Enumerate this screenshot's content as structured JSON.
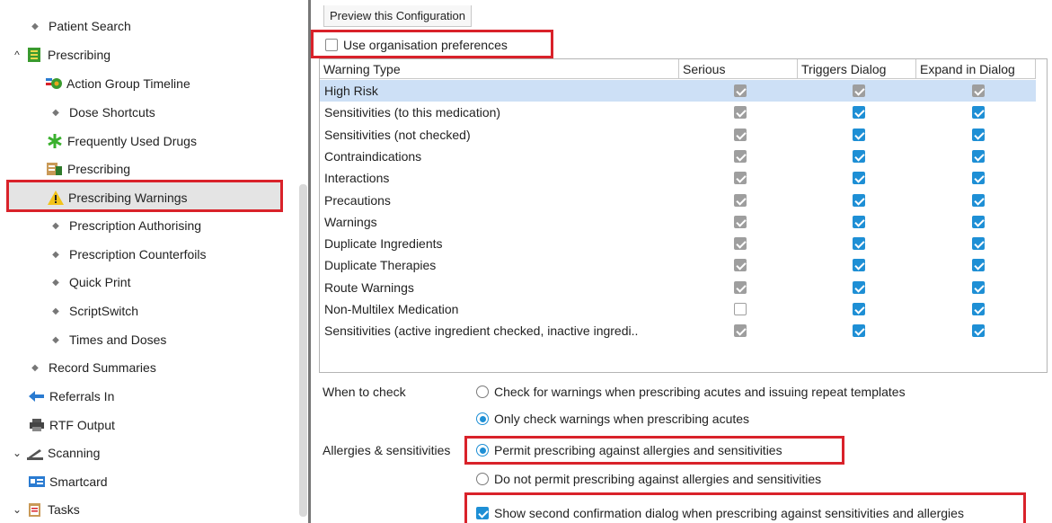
{
  "sidebar": {
    "items": [
      {
        "label": "Patient Search",
        "type": "leaf"
      },
      {
        "label": "Prescribing",
        "type": "group",
        "expanded": true,
        "icon": "prescribing-group-icon"
      },
      {
        "label": "Action Group Timeline",
        "type": "child-icon",
        "icon": "action-group-icon"
      },
      {
        "label": "Dose Shortcuts",
        "type": "child"
      },
      {
        "label": "Frequently Used Drugs",
        "type": "child-icon",
        "icon": "asterisk-icon"
      },
      {
        "label": "Prescribing",
        "type": "child-icon",
        "icon": "prescribing-icon"
      },
      {
        "label": "Prescribing Warnings",
        "type": "child-icon",
        "icon": "warning-icon",
        "selected": true
      },
      {
        "label": "Prescription Authorising",
        "type": "child"
      },
      {
        "label": "Prescription Counterfoils",
        "type": "child"
      },
      {
        "label": "Quick Print",
        "type": "child"
      },
      {
        "label": "ScriptSwitch",
        "type": "child"
      },
      {
        "label": "Times and Doses",
        "type": "child"
      },
      {
        "label": "Record Summaries",
        "type": "leaf"
      },
      {
        "label": "Referrals In",
        "type": "leaf-icon",
        "icon": "referrals-icon"
      },
      {
        "label": "RTF Output",
        "type": "leaf-icon",
        "icon": "printer-icon"
      },
      {
        "label": "Scanning",
        "type": "group",
        "expanded": true,
        "icon": "scanning-icon"
      },
      {
        "label": "Smartcard",
        "type": "leaf-icon",
        "icon": "smartcard-icon"
      },
      {
        "label": "Tasks",
        "type": "group",
        "expanded": true,
        "icon": "tasks-icon"
      }
    ]
  },
  "main": {
    "preview_button": "Preview this Configuration",
    "use_org_prefs": {
      "label": "Use organisation preferences",
      "checked": false
    },
    "table": {
      "columns": [
        "Warning Type",
        "Serious",
        "Triggers Dialog",
        "Expand in Dialog"
      ],
      "rows": [
        {
          "name": "High Risk",
          "serious": "disabled-checked",
          "triggers": "disabled-checked",
          "expand": "disabled-checked",
          "highlight": true
        },
        {
          "name": "Sensitivities (to this medication)",
          "serious": "disabled-checked",
          "triggers": "checked",
          "expand": "checked"
        },
        {
          "name": "Sensitivities (not checked)",
          "serious": "disabled-checked",
          "triggers": "checked",
          "expand": "checked"
        },
        {
          "name": "Contraindications",
          "serious": "disabled-checked",
          "triggers": "checked",
          "expand": "checked"
        },
        {
          "name": "Interactions",
          "serious": "disabled-checked",
          "triggers": "checked",
          "expand": "checked"
        },
        {
          "name": "Precautions",
          "serious": "disabled-checked",
          "triggers": "checked",
          "expand": "checked"
        },
        {
          "name": "Warnings",
          "serious": "disabled-checked",
          "triggers": "checked",
          "expand": "checked"
        },
        {
          "name": "Duplicate Ingredients",
          "serious": "disabled-checked",
          "triggers": "checked",
          "expand": "checked"
        },
        {
          "name": "Duplicate Therapies",
          "serious": "disabled-checked",
          "triggers": "checked",
          "expand": "checked"
        },
        {
          "name": "Route Warnings",
          "serious": "disabled-checked",
          "triggers": "checked",
          "expand": "checked"
        },
        {
          "name": "Non-Multilex Medication",
          "serious": "disabled-empty",
          "triggers": "checked",
          "expand": "checked"
        },
        {
          "name": "Sensitivities (active ingredient checked, inactive ingredi..",
          "serious": "disabled-checked",
          "triggers": "checked",
          "expand": "checked"
        }
      ]
    },
    "when_to_check": {
      "label": "When to check",
      "options": [
        {
          "label": "Check for warnings when prescribing acutes and issuing repeat templates",
          "selected": false
        },
        {
          "label": "Only check warnings when prescribing acutes",
          "selected": true
        }
      ]
    },
    "allergies": {
      "label": "Allergies & sensitivities",
      "options": [
        {
          "label": "Permit prescribing against allergies and sensitivities",
          "selected": true
        },
        {
          "label": "Do not permit prescribing against allergies and sensitivities",
          "selected": false
        }
      ]
    },
    "second_confirmation": {
      "label": "Show second confirmation dialog when prescribing against sensitivities and allergies",
      "checked": true
    }
  },
  "colors": {
    "accent": "#1e8fd5",
    "highlight_box": "#d9222a",
    "selected_row_bg": "#cde0f6"
  }
}
